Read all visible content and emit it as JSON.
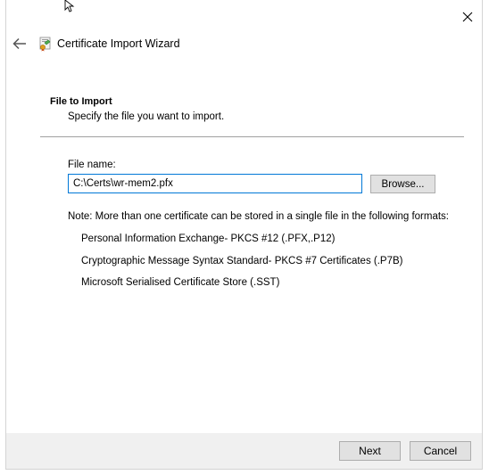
{
  "window": {
    "title": "Certificate Import Wizard",
    "close_icon": "close-icon",
    "back_icon": "back-arrow-icon",
    "app_icon": "certificate-icon"
  },
  "section": {
    "heading": "File to Import",
    "subheading": "Specify the file you want to import."
  },
  "file": {
    "label": "File name:",
    "value": "C:\\Certs\\wr-mem2.pfx",
    "browse_label": "Browse..."
  },
  "note": "Note:  More than one certificate can be stored in a single file in the following formats:",
  "formats": [
    "Personal Information Exchange- PKCS #12 (.PFX,.P12)",
    "Cryptographic Message Syntax Standard- PKCS #7 Certificates (.P7B)",
    "Microsoft Serialised Certificate Store (.SST)"
  ],
  "footer": {
    "next_label": "Next",
    "cancel_label": "Cancel"
  },
  "colors": {
    "focus_border": "#0078d7",
    "footer_bg": "#f0f0f0",
    "button_bg": "#e1e1e1"
  }
}
